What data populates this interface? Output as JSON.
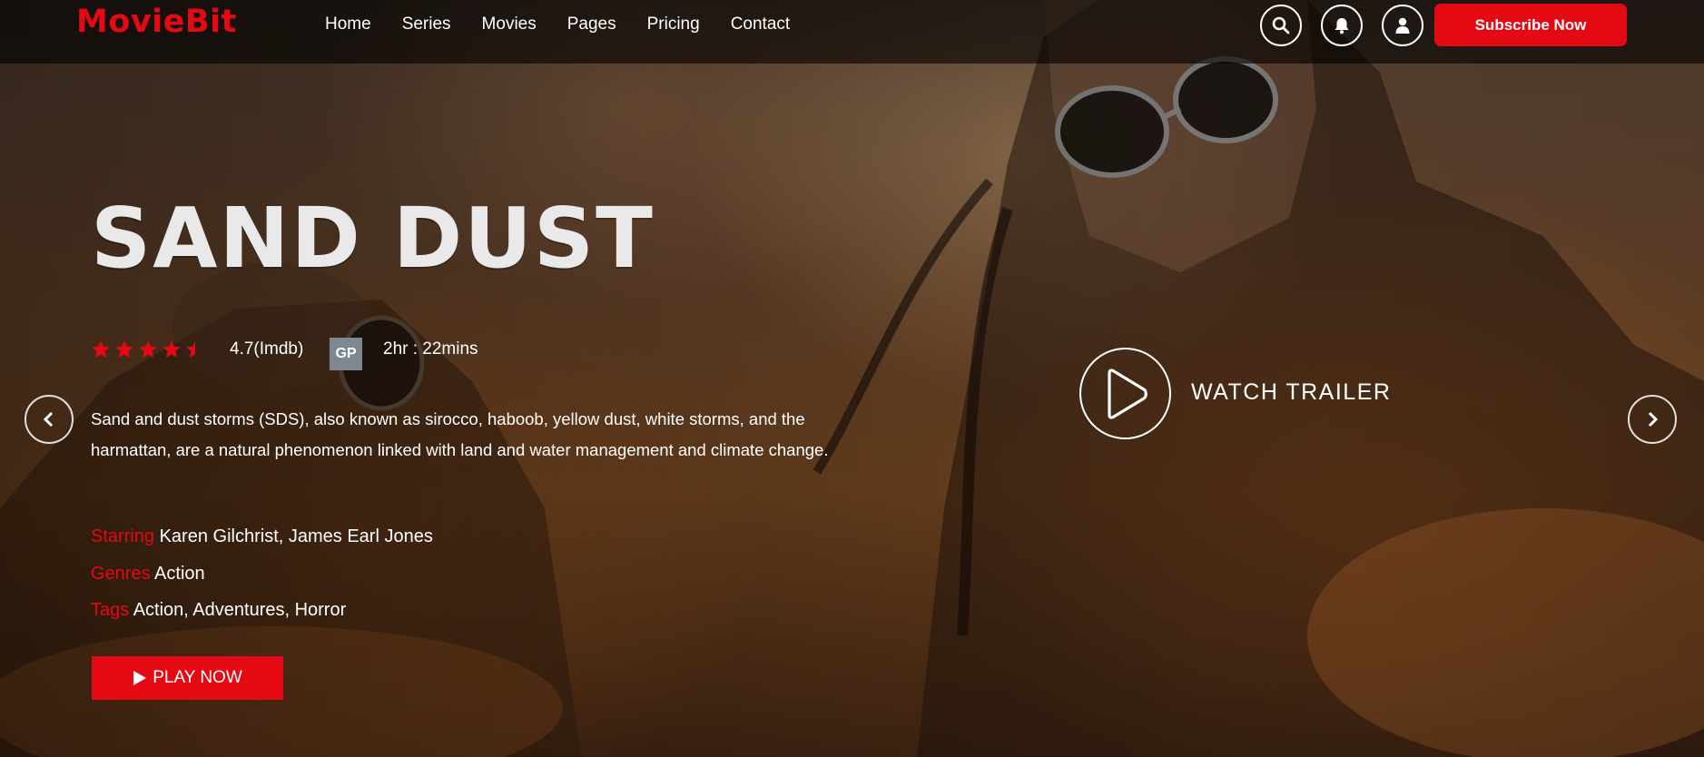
{
  "brand": {
    "name": "MovieBit",
    "accent": "#e50914"
  },
  "nav": [
    "Home",
    "Series",
    "Movies",
    "Pages",
    "Pricing",
    "Contact"
  ],
  "header_icons": [
    "search-icon",
    "bell-icon",
    "user-icon"
  ],
  "subscribe_label": "Subscribe Now",
  "hero": {
    "title": "SAND DUST",
    "rating": {
      "stars": 4.5,
      "max": 5,
      "text": "4.7(Imdb)"
    },
    "badge": "GP",
    "duration": "2hr : 22mins",
    "description": "Sand and dust storms (SDS), also known as sirocco, haboob, yellow dust, white storms, and the harmattan, are a natural phenomenon linked with land and water management and climate change.",
    "starring": {
      "label": "Starring",
      "value": "Karen Gilchrist, James Earl Jones"
    },
    "genres": {
      "label": "Genres",
      "value": "Action"
    },
    "tags": {
      "label": "Tags",
      "value": "Action, Adventures, Horror"
    },
    "play_label": "PLAY NOW",
    "trailer_label": "WATCH TRAILER"
  }
}
